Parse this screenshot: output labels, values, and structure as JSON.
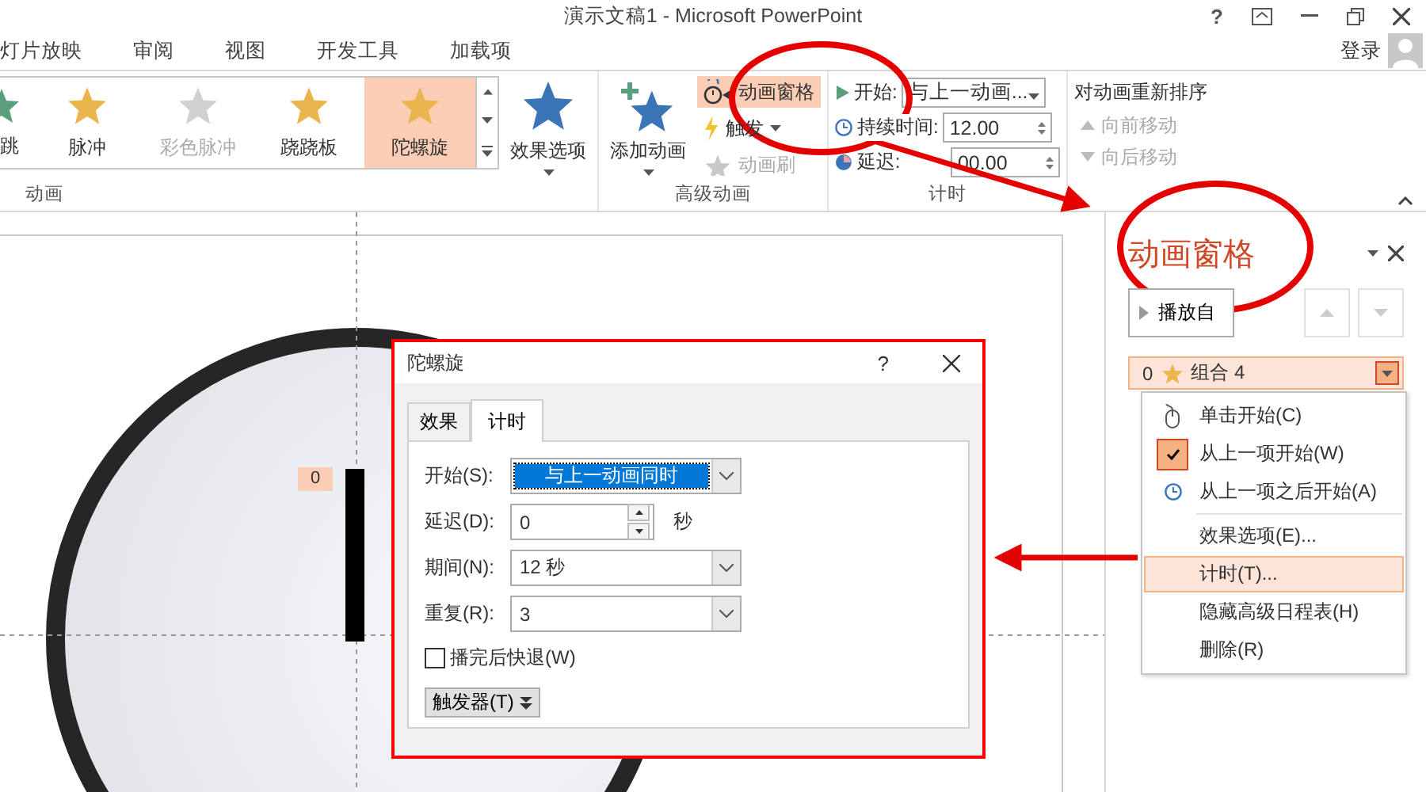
{
  "window": {
    "title": "演示文稿1 - Microsoft PowerPoint",
    "help": "?"
  },
  "ribbon_tabs": [
    {
      "label": "灯片放映"
    },
    {
      "label": "审阅"
    },
    {
      "label": "视图"
    },
    {
      "label": "开发工具"
    },
    {
      "label": "加载项"
    }
  ],
  "account": {
    "label": "登录"
  },
  "animation_group": {
    "items": [
      {
        "label": "跳",
        "color": "#5a9e7e",
        "selected": false,
        "disabled": false
      },
      {
        "label": "脉冲",
        "color": "#eab54d",
        "selected": false,
        "disabled": false
      },
      {
        "label": "彩色脉冲",
        "color": "#d0d0d0",
        "selected": false,
        "disabled": true
      },
      {
        "label": "跷跷板",
        "color": "#eab54d",
        "selected": false,
        "disabled": false
      },
      {
        "label": "陀螺旋",
        "color": "#eab54d",
        "selected": true,
        "disabled": false
      }
    ],
    "effect_options": "效果选项",
    "group_label": "动画"
  },
  "advanced_animation": {
    "add_animation": "添加动画",
    "pane_button": {
      "label": "动画窗格",
      "selected": true
    },
    "trigger": "触发",
    "painter": {
      "label": "动画刷",
      "disabled": true
    },
    "group_label": "高级动画"
  },
  "timing": {
    "start_label": "开始:",
    "start_value": "与上一动画...",
    "duration_label": "持续时间:",
    "duration_value": "12.00",
    "delay_label": "延迟:",
    "delay_value": "00.00",
    "group_label": "计时"
  },
  "reorder": {
    "title": "对动画重新排序",
    "items": [
      {
        "label": "向前移动",
        "disabled": true
      },
      {
        "label": "向后移动",
        "disabled": true
      }
    ]
  },
  "slide": {
    "badge": "0"
  },
  "animation_pane": {
    "title": "动画窗格",
    "play_button": "播放自",
    "item": {
      "number": "0",
      "label": "组合 4"
    },
    "start_options": [
      {
        "label": "单击开始(C)",
        "kind": "click",
        "checked": false
      },
      {
        "label": "从上一项开始(W)",
        "kind": "with_previous",
        "checked": true
      },
      {
        "label": "从上一项之后开始(A)",
        "kind": "after_previous",
        "checked": false
      }
    ],
    "commands": [
      {
        "label": "效果选项(E)...",
        "selected": false
      },
      {
        "label": "计时(T)...",
        "selected": true
      },
      {
        "label": "隐藏高级日程表(H)",
        "selected": false
      },
      {
        "label": "删除(R)",
        "selected": false
      }
    ]
  },
  "dialog": {
    "title": "陀螺旋",
    "help": "?",
    "tabs": [
      {
        "label": "效果",
        "selected": false
      },
      {
        "label": "计时",
        "selected": true
      }
    ],
    "fields": [
      {
        "kind": "dropdown",
        "label": "开始(S):",
        "value": "与上一动画同时",
        "highlighted": true
      },
      {
        "kind": "spinner",
        "label": "延迟(D):",
        "value": "0",
        "unit": "秒",
        "highlighted": false
      },
      {
        "kind": "dropdown",
        "label": "期间(N):",
        "value": "12 秒",
        "highlighted": false
      },
      {
        "kind": "dropdown",
        "label": "重复(R):",
        "value": "3",
        "highlighted": false
      }
    ],
    "rewind": {
      "label": "播完后快退(W)",
      "checked": false
    },
    "trigger_button": "触发器(T)"
  }
}
